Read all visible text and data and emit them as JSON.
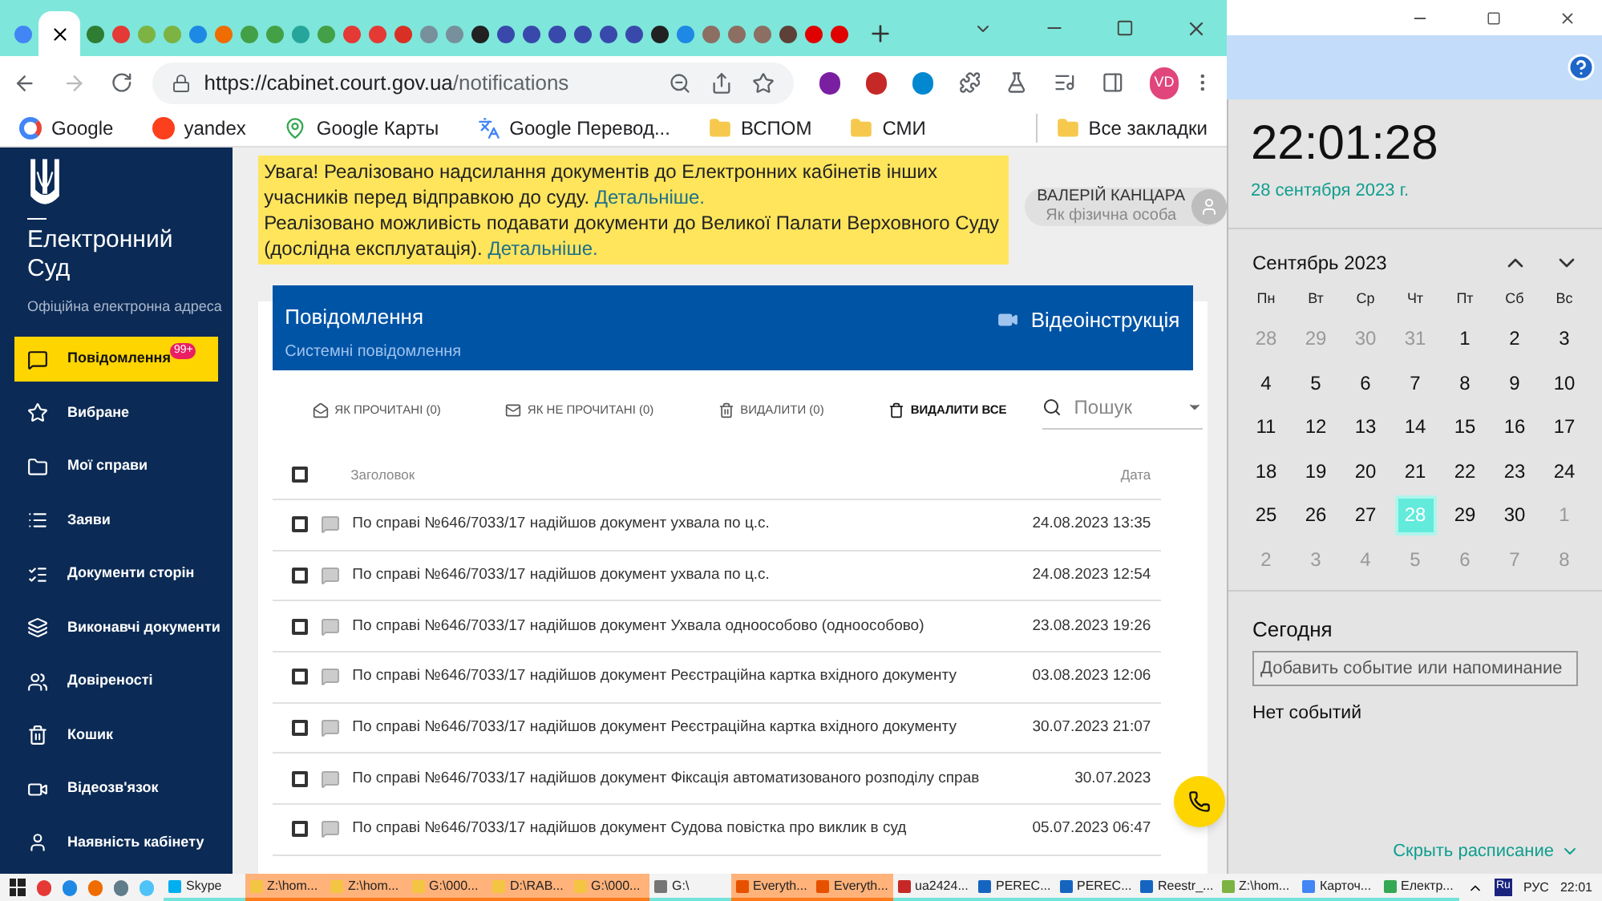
{
  "browser": {
    "tabs": [
      {
        "selected": false
      },
      {
        "selected": true
      },
      {
        "selected": false
      },
      {
        "selected": false
      },
      {
        "selected": false
      },
      {
        "selected": false
      },
      {
        "selected": false
      },
      {
        "selected": false
      },
      {
        "selected": false
      },
      {
        "selected": false
      },
      {
        "selected": false
      },
      {
        "selected": false
      },
      {
        "selected": false
      },
      {
        "selected": false
      },
      {
        "selected": false
      },
      {
        "selected": false
      },
      {
        "selected": false
      },
      {
        "selected": false
      },
      {
        "selected": false
      },
      {
        "selected": false
      },
      {
        "selected": false
      },
      {
        "selected": false
      },
      {
        "selected": false
      },
      {
        "selected": false
      },
      {
        "selected": false
      },
      {
        "selected": false
      },
      {
        "selected": false
      },
      {
        "selected": false
      },
      {
        "selected": false
      },
      {
        "selected": false
      },
      {
        "selected": false
      },
      {
        "selected": false
      }
    ],
    "url_host": "https://cabinet.court.gov.ua",
    "url_path": "/notifications",
    "profile": "VD",
    "extensions": [
      {
        "color": "#7b1fa2"
      },
      {
        "color": "#c62828"
      },
      {
        "color": "#0288d1"
      }
    ],
    "bookmarks": [
      {
        "label": "Google",
        "kind": "google"
      },
      {
        "label": "yandex",
        "kind": "yandex"
      },
      {
        "label": "Google Карты",
        "kind": "maps"
      },
      {
        "label": "Google Перевод...",
        "kind": "translate"
      },
      {
        "label": "ВСПОМ",
        "kind": "folder"
      },
      {
        "label": "СМИ",
        "kind": "folder"
      }
    ],
    "all_bookmarks": "Все закладки"
  },
  "sidebar": {
    "title_line1": "Електронний",
    "title_line2": "Суд",
    "subtitle": "Офіційна електронна адреса",
    "items": [
      {
        "label": "Повідомлення",
        "selected": true,
        "badge": "99+"
      },
      {
        "label": "Вибране",
        "selected": false
      },
      {
        "label": "Мої справи",
        "selected": false
      },
      {
        "label": "Заяви",
        "selected": false
      },
      {
        "label": "Документи сторін",
        "selected": false
      },
      {
        "label": "Виконавчі документи",
        "selected": false
      },
      {
        "label": "Довіреності",
        "selected": false
      },
      {
        "label": "Кошик",
        "selected": false
      },
      {
        "label": "Відеозв'язок",
        "selected": false
      },
      {
        "label": "Наявність кабінету",
        "selected": false
      }
    ]
  },
  "banner": [
    {
      "text": "Увага! Реалізовано надсилання документів до Електронних кабінетів інших учасників перед відправкою до суду.",
      "link": "Детальніше."
    },
    {
      "text": "Реалізовано можливість подавати документи до Великої Палати Верховного Суду (дослідна експлуатація).",
      "link": "Детальніше."
    }
  ],
  "user": {
    "name": "ВАЛЕРІЙ КАНЦАРА",
    "role": "Як фізична особа"
  },
  "panel": {
    "title": "Повідомлення",
    "subtitle": "Системні повідомлення",
    "video_link": "Відеоінструкція",
    "actions": [
      {
        "label": "ЯК ПРОЧИТАНІ (0)",
        "emphasis": false
      },
      {
        "label": "ЯК НЕ ПРОЧИТАНІ (0)",
        "emphasis": false
      },
      {
        "label": "ВИДАЛИТИ (0)",
        "emphasis": false
      },
      {
        "label": "ВИДАЛИТИ ВСЕ",
        "emphasis": true
      }
    ],
    "search": {
      "placeholder": "Пошук"
    },
    "select_all_checked": false,
    "columns": [
      "Заголовок",
      "Дата"
    ],
    "rows": [
      {
        "title": "По справі №646/7033/17 надійшов документ ухвала по ц.с.",
        "date": "24.08.2023 13:35",
        "checked": false
      },
      {
        "title": "По справі №646/7033/17 надійшов документ ухвала по ц.с.",
        "date": "24.08.2023 12:54",
        "checked": false
      },
      {
        "title": "По справі №646/7033/17 надійшов документ Ухвала одноособово (одноособово)",
        "date": "23.08.2023 19:26",
        "checked": false
      },
      {
        "title": "По справі №646/7033/17 надійшов документ Реєстраційна картка вхідного документу",
        "date": "03.08.2023 12:06",
        "checked": false
      },
      {
        "title": "По справі №646/7033/17 надійшов документ Реєстраційна картка вхідного документу",
        "date": "30.07.2023 21:07",
        "checked": false
      },
      {
        "title": "По справі №646/7033/17 надійшов документ Фіксація автоматизованого розподілу справ",
        "date": "30.07.2023",
        "checked": false
      },
      {
        "title": "По справі №646/7033/17 надійшов документ Судова повістка про виклик в суд",
        "date": "05.07.2023 06:47",
        "checked": false
      }
    ]
  },
  "clock": {
    "time": "22:01:28",
    "date": "28 сентября 2023 г.",
    "month": "Сентябрь 2023",
    "weekdays": [
      "Пн",
      "Вт",
      "Ср",
      "Чт",
      "Пт",
      "Сб",
      "Вс"
    ],
    "days": [
      {
        "d": "28",
        "muted": true,
        "selected": false
      },
      {
        "d": "29",
        "muted": true,
        "selected": false
      },
      {
        "d": "30",
        "muted": true,
        "selected": false
      },
      {
        "d": "31",
        "muted": true,
        "selected": false
      },
      {
        "d": "1",
        "muted": false,
        "selected": false
      },
      {
        "d": "2",
        "muted": false,
        "selected": false
      },
      {
        "d": "3",
        "muted": false,
        "selected": false
      },
      {
        "d": "4",
        "muted": false,
        "selected": false
      },
      {
        "d": "5",
        "muted": false,
        "selected": false
      },
      {
        "d": "6",
        "muted": false,
        "selected": false
      },
      {
        "d": "7",
        "muted": false,
        "selected": false
      },
      {
        "d": "8",
        "muted": false,
        "selected": false
      },
      {
        "d": "9",
        "muted": false,
        "selected": false
      },
      {
        "d": "10",
        "muted": false,
        "selected": false
      },
      {
        "d": "11",
        "muted": false,
        "selected": false
      },
      {
        "d": "12",
        "muted": false,
        "selected": false
      },
      {
        "d": "13",
        "muted": false,
        "selected": false
      },
      {
        "d": "14",
        "muted": false,
        "selected": false
      },
      {
        "d": "15",
        "muted": false,
        "selected": false
      },
      {
        "d": "16",
        "muted": false,
        "selected": false
      },
      {
        "d": "17",
        "muted": false,
        "selected": false
      },
      {
        "d": "18",
        "muted": false,
        "selected": false
      },
      {
        "d": "19",
        "muted": false,
        "selected": false
      },
      {
        "d": "20",
        "muted": false,
        "selected": false
      },
      {
        "d": "21",
        "muted": false,
        "selected": false
      },
      {
        "d": "22",
        "muted": false,
        "selected": false
      },
      {
        "d": "23",
        "muted": false,
        "selected": false
      },
      {
        "d": "24",
        "muted": false,
        "selected": false
      },
      {
        "d": "25",
        "muted": false,
        "selected": false
      },
      {
        "d": "26",
        "muted": false,
        "selected": false
      },
      {
        "d": "27",
        "muted": false,
        "selected": false
      },
      {
        "d": "28",
        "muted": false,
        "selected": true
      },
      {
        "d": "29",
        "muted": false,
        "selected": false
      },
      {
        "d": "30",
        "muted": false,
        "selected": false
      },
      {
        "d": "1",
        "muted": true,
        "selected": false
      },
      {
        "d": "2",
        "muted": true,
        "selected": false
      },
      {
        "d": "3",
        "muted": true,
        "selected": false
      },
      {
        "d": "4",
        "muted": true,
        "selected": false
      },
      {
        "d": "5",
        "muted": true,
        "selected": false
      },
      {
        "d": "6",
        "muted": true,
        "selected": false
      },
      {
        "d": "7",
        "muted": true,
        "selected": false
      },
      {
        "d": "8",
        "muted": true,
        "selected": false
      }
    ],
    "today": "Сегодня",
    "event_field": {
      "placeholder": "Добавить событие или напоминание"
    },
    "no_events": "Нет событий",
    "hide_schedule": "Скрыть расписание"
  },
  "taskbar": {
    "items": [
      {
        "label": "Skype",
        "flashing": false
      },
      {
        "label": "Z:\\hom...",
        "flashing": true
      },
      {
        "label": "Z:\\hom...",
        "flashing": true
      },
      {
        "label": "G:\\000...",
        "flashing": true
      },
      {
        "label": "D:\\RAB...",
        "flashing": true
      },
      {
        "label": "G:\\000...",
        "flashing": true
      },
      {
        "label": "G:\\",
        "flashing": false
      },
      {
        "label": "Everyth...",
        "flashing": true
      },
      {
        "label": "Everyth...",
        "flashing": true
      },
      {
        "label": "ua2424...",
        "flashing": false
      },
      {
        "label": "PEREC...",
        "flashing": false
      },
      {
        "label": "PEREC...",
        "flashing": false
      },
      {
        "label": "Reestr_...",
        "flashing": false
      },
      {
        "label": "Z:\\hom...",
        "flashing": false
      },
      {
        "label": "Карточ...",
        "flashing": false
      },
      {
        "label": "Електр...",
        "flashing": false
      }
    ],
    "tray_lang_icon": "Ru",
    "lang": "РУС",
    "time": "22:01"
  }
}
